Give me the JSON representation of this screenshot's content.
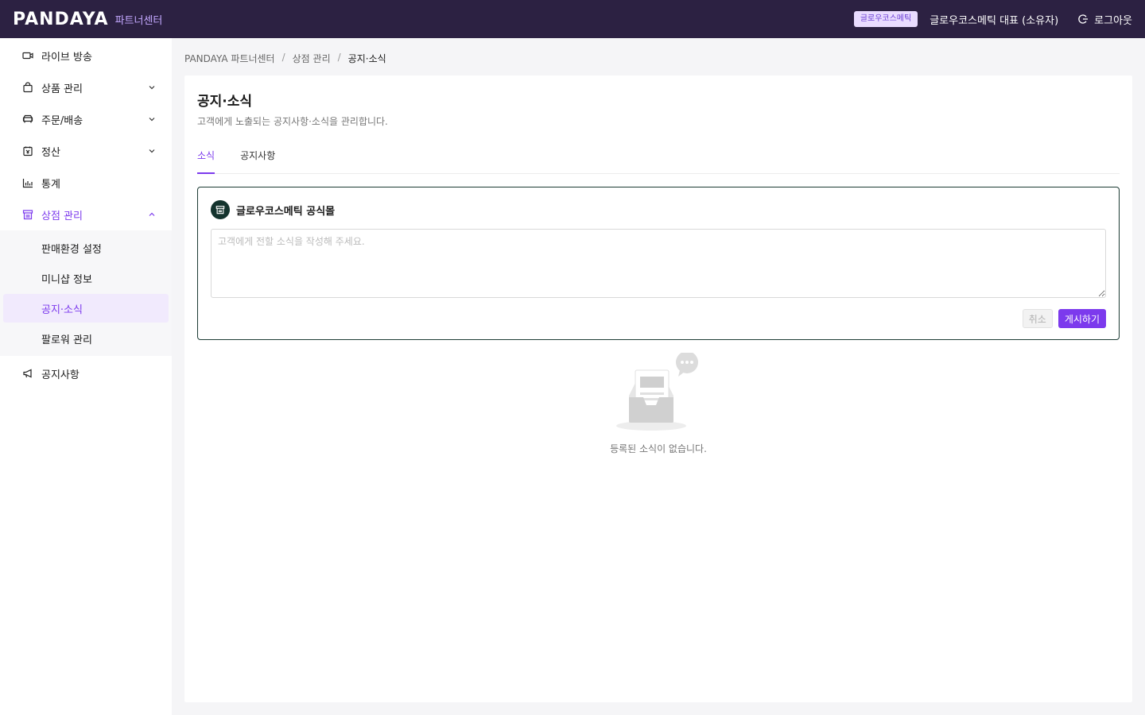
{
  "header": {
    "logo_text": "PANDAYA",
    "logo_subtitle": "파트너센터",
    "shop_badge": "글로우코스메틱",
    "user_name": "글로우코스메틱 대표 (소유자)",
    "logout_label": "로그아웃"
  },
  "sidebar": {
    "items": [
      {
        "label": "라이브 방송",
        "icon": "video-icon"
      },
      {
        "label": "상품 관리",
        "icon": "shopping-bag-icon"
      },
      {
        "label": "주문/배송",
        "icon": "truck-icon"
      },
      {
        "label": "정산",
        "icon": "receipt-icon"
      },
      {
        "label": "통계",
        "icon": "bar-chart-icon"
      },
      {
        "label": "상점 관리",
        "icon": "storefront-icon"
      },
      {
        "label": "공지사항",
        "icon": "megaphone-icon"
      }
    ],
    "store_submenu": [
      {
        "label": "판매환경 설정"
      },
      {
        "label": "미니샵 정보"
      },
      {
        "label": "공지·소식"
      },
      {
        "label": "팔로워 관리"
      }
    ]
  },
  "breadcrumb": [
    "PANDAYA 파트너센터",
    "상점 관리",
    "공지·소식"
  ],
  "page": {
    "title": "공지·소식",
    "description": "고객에게 노출되는 공지사항·소식을 관리합니다.",
    "tabs": [
      {
        "label": "소식"
      },
      {
        "label": "공지사항"
      }
    ]
  },
  "compose": {
    "store_name": "글로우코스메틱 공식몰",
    "placeholder": "고객에게 전할 소식을 작성해 주세요.",
    "value": "",
    "cancel_label": "취소",
    "post_label": "게시하기"
  },
  "empty_state": {
    "message": "등록된 소식이 없습니다."
  },
  "colors": {
    "header_bg": "#2c2142",
    "accent": "#7c3aed",
    "compose_border": "#1c3b34"
  }
}
